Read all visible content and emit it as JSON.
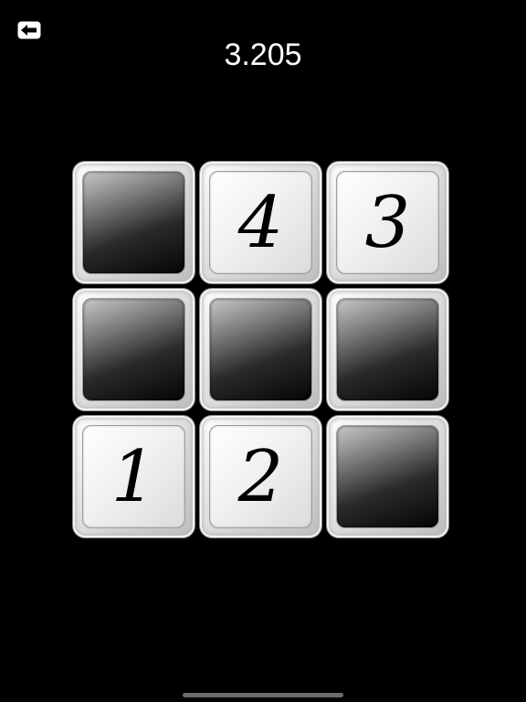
{
  "header": {
    "back_icon": "back-arrow-icon",
    "timer": "3.205"
  },
  "board": {
    "rows": 3,
    "cols": 3,
    "tiles": [
      {
        "state": "dark",
        "label": ""
      },
      {
        "state": "light",
        "label": "4"
      },
      {
        "state": "light",
        "label": "3"
      },
      {
        "state": "dark",
        "label": ""
      },
      {
        "state": "dark",
        "label": ""
      },
      {
        "state": "dark",
        "label": ""
      },
      {
        "state": "light",
        "label": "1"
      },
      {
        "state": "light",
        "label": "2"
      },
      {
        "state": "dark",
        "label": ""
      }
    ]
  },
  "colors": {
    "background": "#000000",
    "text": "#ffffff",
    "digit": "#000000"
  }
}
